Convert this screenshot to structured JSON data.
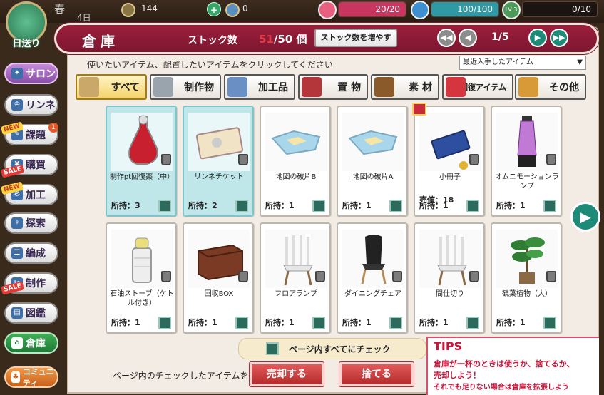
{
  "status_bar": {
    "season": "春",
    "day": "4日",
    "calendar_label": "日送り",
    "money": "144",
    "points": "0",
    "hearts": "20/20",
    "stamina": "100/100",
    "level_badge": "LV 3",
    "level_progress": "0/10",
    "colors": {
      "hearts": "#c8365f",
      "stamina": "#2f9aa6"
    }
  },
  "sidebar": {
    "items": [
      {
        "label": "サロン",
        "icon": "salon-icon"
      },
      {
        "label": "リンネ",
        "icon": "rinne-icon"
      },
      {
        "label": "課題",
        "icon": "task-icon",
        "tag": "NEW",
        "badge": "1"
      },
      {
        "label": "購買",
        "icon": "shop-icon",
        "tag": "SALE"
      },
      {
        "label": "加工",
        "icon": "process-icon",
        "tag": "NEW"
      },
      {
        "label": "探索",
        "icon": "explore-icon"
      },
      {
        "label": "編成",
        "icon": "party-icon"
      },
      {
        "label": "制作",
        "icon": "craft-icon",
        "tag": "SALE"
      },
      {
        "label": "図鑑",
        "icon": "book-icon"
      },
      {
        "label": "倉庫",
        "icon": "house-icon"
      },
      {
        "label": "コミュニティ",
        "icon": "community-icon"
      }
    ]
  },
  "header": {
    "title": "倉庫",
    "stock_label": "ストック数",
    "stock_current": "51",
    "stock_max": "/50 個",
    "stock_button": "ストック数を増やす",
    "page_indicator": "1/5",
    "first_page": "◀◀",
    "prev_page": "◀",
    "next_page": "▶",
    "last_page": "▶▶"
  },
  "instruction": "使いたいアイテム、配置したいアイテムをクリックしてください",
  "sort": {
    "selected": "最近入手したアイテム",
    "arrow": "▼"
  },
  "categories": [
    {
      "label": "すべて",
      "active": true
    },
    {
      "label": "制作物"
    },
    {
      "label": "加工品"
    },
    {
      "label": "置 物"
    },
    {
      "label": "素 材"
    },
    {
      "label": "回復アイテム"
    },
    {
      "label": "その他"
    }
  ],
  "items": [
    {
      "name": "制作pt回復薬（中）",
      "qty": "所持：3",
      "selected": true
    },
    {
      "name": "リンネチケット",
      "qty": "所持：2",
      "selected": true
    },
    {
      "name": "地図の破片B",
      "qty": "所持：1"
    },
    {
      "name": "地図の破片A",
      "qty": "所持：1"
    },
    {
      "name": "小冊子",
      "qty": "所持：1",
      "sold": "売値：18"
    },
    {
      "name": "オムニモーションランプ",
      "qty": "所持：1"
    },
    {
      "name": "石油ストーブ（ケトル付き）",
      "qty": "所持：1"
    },
    {
      "name": "回収BOX",
      "qty": "所持：1"
    },
    {
      "name": "フロアランプ",
      "qty": "所持：1"
    },
    {
      "name": "ダイニングチェア",
      "qty": "所持：1"
    },
    {
      "name": "間仕切り",
      "qty": "所持：1"
    },
    {
      "name": "観葉植物（大）",
      "qty": "所持：1"
    }
  ],
  "next_arrow": "▶",
  "bottom": {
    "check_all": "ページ内すべてにチェック",
    "checked_label": "ページ内のチェックしたアイテムを",
    "sell_button": "売却する",
    "discard_button": "捨てる"
  },
  "tips": {
    "title": "TIPS",
    "line1": "倉庫が一杯のときは使うか、捨てるか、",
    "line2": "売却しよう！",
    "line3": "それでも足りない場合は倉庫を拡張しよう"
  }
}
